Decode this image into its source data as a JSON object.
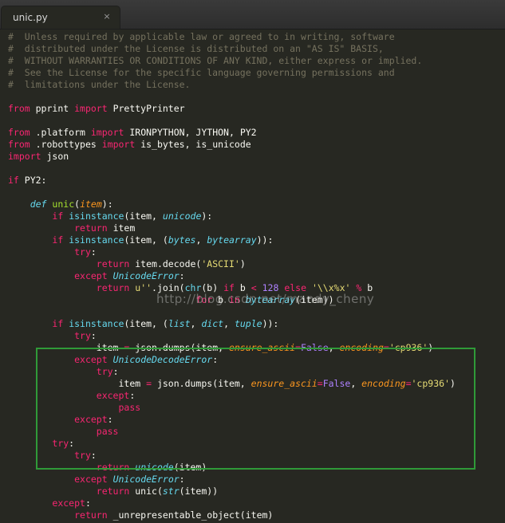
{
  "window": {
    "tab": {
      "title": "unic.py",
      "close_symbol": "×"
    }
  },
  "editor": {
    "watermark": "http://blog.csdn.net/mandy_cheny",
    "highlight_color": "#2f9a38",
    "theme": {
      "background": "#272822",
      "comment": "#75715e",
      "keyword": "#f92672",
      "function": "#a6e22e",
      "builtin": "#66d9ef",
      "string": "#e6db74",
      "number": "#ae81ff",
      "parameter": "#fd971f",
      "text": "#f8f8f2"
    },
    "lines": [
      [
        [
          "cmt",
          "#  Unless required by applicable law or agreed to in writing, software"
        ]
      ],
      [
        [
          "cmt",
          "#  distributed under the License is distributed on an \"AS IS\" BASIS,"
        ]
      ],
      [
        [
          "cmt",
          "#  WITHOUT WARRANTIES OR CONDITIONS OF ANY KIND, either express or implied."
        ]
      ],
      [
        [
          "cmt",
          "#  See the License for the specific language governing permissions and"
        ]
      ],
      [
        [
          "cmt",
          "#  limitations under the License."
        ]
      ],
      [],
      [
        [
          "kw",
          "from"
        ],
        [
          "",
          " pprint "
        ],
        [
          "kw",
          "import"
        ],
        [
          "",
          " PrettyPrinter"
        ]
      ],
      [],
      [
        [
          "kw",
          "from"
        ],
        [
          "",
          " .platform "
        ],
        [
          "kw",
          "import"
        ],
        [
          "",
          " IRONPYTHON, JYTHON, PY2"
        ]
      ],
      [
        [
          "kw",
          "from"
        ],
        [
          "",
          " .robottypes "
        ],
        [
          "kw",
          "import"
        ],
        [
          "",
          " is_bytes, is_unicode"
        ]
      ],
      [
        [
          "kw",
          "import"
        ],
        [
          "",
          " json"
        ]
      ],
      [],
      [
        [
          "kw",
          "if"
        ],
        [
          "",
          " PY2:"
        ]
      ],
      [],
      [
        [
          "",
          "    "
        ],
        [
          "def",
          "def"
        ],
        [
          "",
          " "
        ],
        [
          "fn",
          "unic"
        ],
        [
          "",
          "("
        ],
        [
          "prm",
          "item"
        ],
        [
          "",
          "):"
        ]
      ],
      [
        [
          "",
          "        "
        ],
        [
          "kw",
          "if"
        ],
        [
          "",
          " "
        ],
        [
          "bi",
          "isinstance"
        ],
        [
          "",
          "(item, "
        ],
        [
          "bii",
          "unicode"
        ],
        [
          "",
          "):"
        ]
      ],
      [
        [
          "",
          "            "
        ],
        [
          "kw",
          "return"
        ],
        [
          "",
          " item"
        ]
      ],
      [
        [
          "",
          "        "
        ],
        [
          "kw",
          "if"
        ],
        [
          "",
          " "
        ],
        [
          "bi",
          "isinstance"
        ],
        [
          "",
          "(item, ("
        ],
        [
          "bii",
          "bytes"
        ],
        [
          "",
          ", "
        ],
        [
          "bii",
          "bytearray"
        ],
        [
          "",
          ")):"
        ]
      ],
      [
        [
          "",
          "            "
        ],
        [
          "kw",
          "try"
        ],
        [
          "",
          ":"
        ]
      ],
      [
        [
          "",
          "                "
        ],
        [
          "kw",
          "return"
        ],
        [
          "",
          " item.decode("
        ],
        [
          "str",
          "'ASCII'"
        ],
        [
          "",
          ")"
        ]
      ],
      [
        [
          "",
          "            "
        ],
        [
          "kw",
          "except"
        ],
        [
          "",
          " "
        ],
        [
          "bii",
          "UnicodeError"
        ],
        [
          "",
          ":"
        ]
      ],
      [
        [
          "",
          "                "
        ],
        [
          "kw",
          "return"
        ],
        [
          "",
          " "
        ],
        [
          "str",
          "u''"
        ],
        [
          "",
          ".join("
        ],
        [
          "bi",
          "chr"
        ],
        [
          "",
          "(b) "
        ],
        [
          "kw",
          "if"
        ],
        [
          "",
          " b "
        ],
        [
          "kw",
          "<"
        ],
        [
          "",
          " "
        ],
        [
          "num",
          "128"
        ],
        [
          "",
          " "
        ],
        [
          "kw",
          "else"
        ],
        [
          "",
          " "
        ],
        [
          "str",
          "'\\\\x%x'"
        ],
        [
          "",
          " "
        ],
        [
          "kw",
          "%"
        ],
        [
          "",
          " b"
        ]
      ],
      [
        [
          "",
          "                                  "
        ],
        [
          "kw",
          "for"
        ],
        [
          "",
          " b "
        ],
        [
          "kw",
          "in"
        ],
        [
          "",
          " "
        ],
        [
          "bii",
          "bytearray"
        ],
        [
          "",
          "(item))"
        ]
      ],
      [],
      [
        [
          "",
          "        "
        ],
        [
          "kw",
          "if"
        ],
        [
          "",
          " "
        ],
        [
          "bi",
          "isinstance"
        ],
        [
          "",
          "(item, ("
        ],
        [
          "bii",
          "list"
        ],
        [
          "",
          ", "
        ],
        [
          "bii",
          "dict"
        ],
        [
          "",
          ", "
        ],
        [
          "bii",
          "tuple"
        ],
        [
          "",
          ")):"
        ]
      ],
      [
        [
          "",
          "            "
        ],
        [
          "kw",
          "try"
        ],
        [
          "",
          ":"
        ]
      ],
      [
        [
          "",
          "                item "
        ],
        [
          "kw",
          "="
        ],
        [
          "",
          " json.dumps(item, "
        ],
        [
          "prm",
          "ensure_ascii"
        ],
        [
          "kw",
          "="
        ],
        [
          "cn",
          "False"
        ],
        [
          "",
          ", "
        ],
        [
          "prm",
          "encoding"
        ],
        [
          "kw",
          "="
        ],
        [
          "str",
          "'cp936'"
        ],
        [
          "",
          ")"
        ]
      ],
      [
        [
          "",
          "            "
        ],
        [
          "kw",
          "except"
        ],
        [
          "",
          " "
        ],
        [
          "bii",
          "UnicodeDecodeError"
        ],
        [
          "",
          ":"
        ]
      ],
      [
        [
          "",
          "                "
        ],
        [
          "kw",
          "try"
        ],
        [
          "",
          ":"
        ]
      ],
      [
        [
          "",
          "                    item "
        ],
        [
          "kw",
          "="
        ],
        [
          "",
          " json.dumps(item, "
        ],
        [
          "prm",
          "ensure_ascii"
        ],
        [
          "kw",
          "="
        ],
        [
          "cn",
          "False"
        ],
        [
          "",
          ", "
        ],
        [
          "prm",
          "encoding"
        ],
        [
          "kw",
          "="
        ],
        [
          "str",
          "'cp936'"
        ],
        [
          "",
          ")"
        ]
      ],
      [
        [
          "",
          "                "
        ],
        [
          "kw",
          "except"
        ],
        [
          "",
          ":"
        ]
      ],
      [
        [
          "",
          "                    "
        ],
        [
          "kw",
          "pass"
        ]
      ],
      [
        [
          "",
          "            "
        ],
        [
          "kw",
          "except"
        ],
        [
          "",
          ":"
        ]
      ],
      [
        [
          "",
          "                "
        ],
        [
          "kw",
          "pass"
        ]
      ],
      [
        [
          "",
          "        "
        ],
        [
          "kw",
          "try"
        ],
        [
          "",
          ":"
        ]
      ],
      [
        [
          "",
          "            "
        ],
        [
          "kw",
          "try"
        ],
        [
          "",
          ":"
        ]
      ],
      [
        [
          "",
          "                "
        ],
        [
          "kw",
          "return"
        ],
        [
          "",
          " "
        ],
        [
          "bii",
          "unicode"
        ],
        [
          "",
          "(item)"
        ]
      ],
      [
        [
          "",
          "            "
        ],
        [
          "kw",
          "except"
        ],
        [
          "",
          " "
        ],
        [
          "bii",
          "UnicodeError"
        ],
        [
          "",
          ":"
        ]
      ],
      [
        [
          "",
          "                "
        ],
        [
          "kw",
          "return"
        ],
        [
          "",
          " unic("
        ],
        [
          "bii",
          "str"
        ],
        [
          "",
          "(item))"
        ]
      ],
      [
        [
          "",
          "        "
        ],
        [
          "kw",
          "except"
        ],
        [
          "",
          ":"
        ]
      ],
      [
        [
          "",
          "            "
        ],
        [
          "kw",
          "return"
        ],
        [
          "",
          " _unrepresentable_object(item)"
        ]
      ]
    ]
  }
}
